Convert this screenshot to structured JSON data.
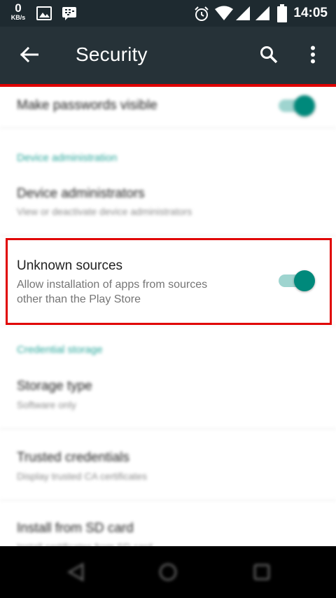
{
  "status_bar": {
    "speed_value": "0",
    "speed_unit": "KB/s",
    "time": "14:05",
    "icons": [
      "image-icon",
      "bbm-icon",
      "alarm-icon",
      "wifi-icon",
      "signal-icon",
      "signal-icon",
      "battery-icon"
    ]
  },
  "toolbar": {
    "title": "Security",
    "back_icon": "arrow-back-icon",
    "search_icon": "search-icon",
    "menu_icon": "more-vert-icon"
  },
  "preferences": {
    "make_passwords_visible": {
      "title": "Make passwords visible",
      "enabled": true
    },
    "device_admin_category": "Device administration",
    "device_administrators": {
      "title": "Device administrators",
      "summary": "View or deactivate device administrators"
    },
    "unknown_sources": {
      "title": "Unknown sources",
      "summary_line1": "Allow installation of apps from sources",
      "summary_line2": "other than the Play Store",
      "enabled": true
    },
    "credential_category": "Credential storage",
    "storage_type": {
      "title": "Storage type",
      "summary": "Software only"
    },
    "trusted_credentials": {
      "title": "Trusted credentials",
      "summary": "Display trusted CA certificates"
    },
    "install_sd": {
      "title": "Install from SD card",
      "summary": "Install certificates from SD card"
    }
  },
  "nav_bar": {
    "icons": [
      "back-nav-icon",
      "home-nav-icon",
      "recents-nav-icon"
    ]
  },
  "colors": {
    "accent": "#009688",
    "highlight": "#e00000",
    "toolbar": "#263238",
    "status_bar": "#1e2a30"
  }
}
